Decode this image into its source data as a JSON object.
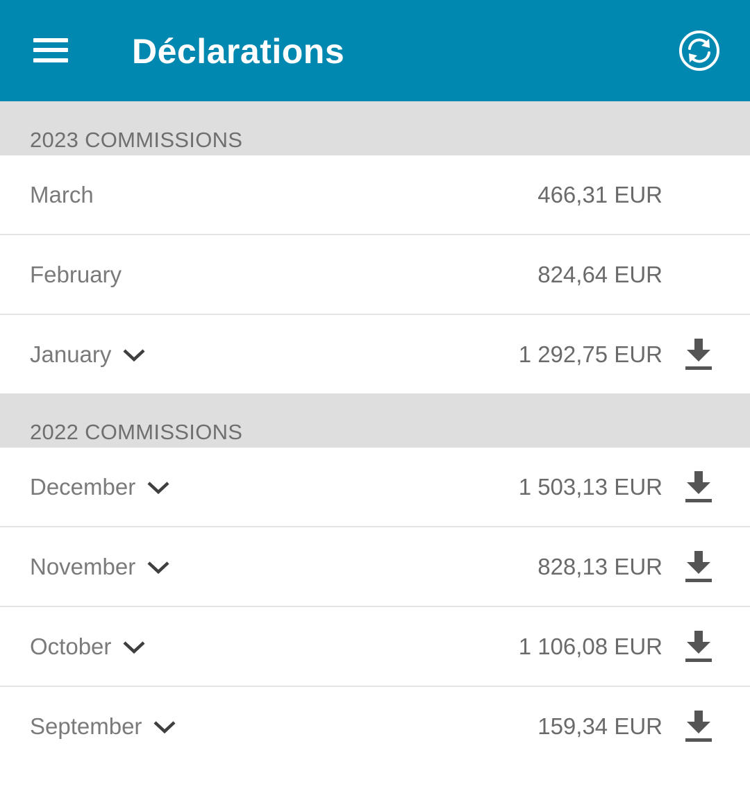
{
  "header": {
    "title": "Déclarations",
    "menu_icon": "menu-icon",
    "sync_icon": "sync-icon",
    "color": "#0088b0"
  },
  "sections": [
    {
      "label": "2023 COMMISSIONS",
      "rows": [
        {
          "month": "March",
          "amount": "466,31 EUR",
          "expandable": false,
          "downloadable": false
        },
        {
          "month": "February",
          "amount": "824,64 EUR",
          "expandable": false,
          "downloadable": false
        },
        {
          "month": "January",
          "amount": "1 292,75 EUR",
          "expandable": true,
          "downloadable": true
        }
      ]
    },
    {
      "label": "2022 COMMISSIONS",
      "rows": [
        {
          "month": "December",
          "amount": "1 503,13 EUR",
          "expandable": true,
          "downloadable": true
        },
        {
          "month": "November",
          "amount": "828,13 EUR",
          "expandable": true,
          "downloadable": true
        },
        {
          "month": "October",
          "amount": "1 106,08 EUR",
          "expandable": true,
          "downloadable": true
        },
        {
          "month": "September",
          "amount": "159,34 EUR",
          "expandable": true,
          "downloadable": true
        }
      ]
    }
  ]
}
